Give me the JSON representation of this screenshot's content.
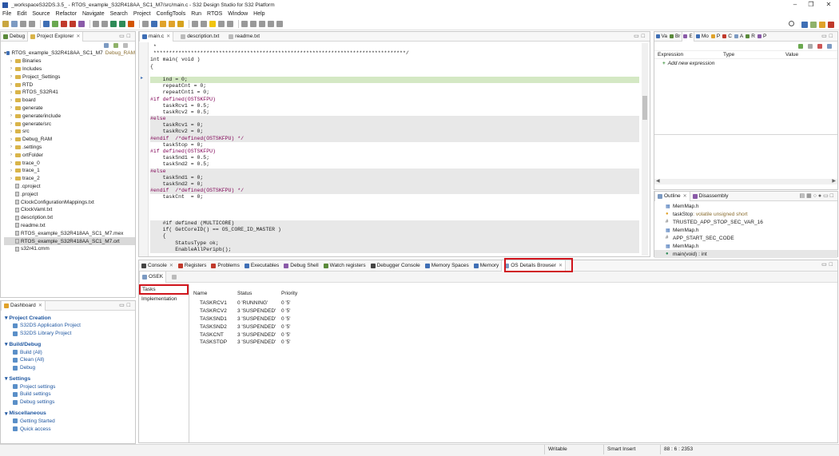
{
  "window": {
    "title": "_workspaceS32DS.3.5_ - RTOS_example_S32R418AA_SC1_M7/src/main.c - S32 Design Studio for S32 Platform"
  },
  "menu": [
    "File",
    "Edit",
    "Source",
    "Refactor",
    "Navigate",
    "Search",
    "Project",
    "ConfigTools",
    "Run",
    "RTOS",
    "Window",
    "Help"
  ],
  "left_panel": {
    "tabs": [
      {
        "label": "Debug"
      },
      {
        "label": "Project Explorer"
      }
    ],
    "project_root": "RTOS_example_S32R418AA_SC1_M7",
    "project_config": "Debug_RAM",
    "tree": [
      {
        "label": "Binaries",
        "kind": "folder"
      },
      {
        "label": "Includes",
        "kind": "folder"
      },
      {
        "label": "Project_Settings",
        "kind": "folder"
      },
      {
        "label": "RTD",
        "kind": "folder"
      },
      {
        "label": "RTOS_S32R41",
        "kind": "folder"
      },
      {
        "label": "board",
        "kind": "folder"
      },
      {
        "label": "generate",
        "kind": "folder"
      },
      {
        "label": "generate/include",
        "kind": "folder"
      },
      {
        "label": "generate/src",
        "kind": "folder"
      },
      {
        "label": "src",
        "kind": "folder"
      },
      {
        "label": "Debug_RAM",
        "kind": "folder"
      },
      {
        "label": ".settings",
        "kind": "folder"
      },
      {
        "label": "ortFolder",
        "kind": "folder"
      },
      {
        "label": "trace_0",
        "kind": "folder"
      },
      {
        "label": "trace_1",
        "kind": "folder"
      },
      {
        "label": "trace_2",
        "kind": "folder"
      },
      {
        "label": ".cproject",
        "kind": "file"
      },
      {
        "label": ".project",
        "kind": "file"
      },
      {
        "label": "ClockConfigurationMappings.txt",
        "kind": "file"
      },
      {
        "label": "ClockVaml.txt",
        "kind": "file"
      },
      {
        "label": "description.txt",
        "kind": "file"
      },
      {
        "label": "readme.txt",
        "kind": "file"
      },
      {
        "label": "RTOS_example_S32R418AA_SC1_M7.mex",
        "kind": "file"
      },
      {
        "label": "RTOS_example_S32R418AA_SC1_M7.ort",
        "kind": "file"
      },
      {
        "label": "s32r41.cmm",
        "kind": "file"
      }
    ]
  },
  "editor": {
    "tabs": [
      {
        "label": "main.c"
      },
      {
        "label": "description.txt"
      },
      {
        "label": "readme.txt"
      }
    ],
    "lines": [
      {
        "text": " *",
        "hl": false
      },
      {
        "text": " *********************************************************************************/",
        "hl": false
      },
      {
        "text": "int main( void )",
        "hl": false
      },
      {
        "text": "{",
        "hl": false
      },
      {
        "text": "",
        "hl": false
      },
      {
        "text": "    ind = 0;",
        "hl": false,
        "green": true
      },
      {
        "text": "    repeatCnt = 0;",
        "hl": false
      },
      {
        "text": "    repeatCnt1 = 0;",
        "hl": false
      },
      {
        "text": "#if defined(OSTSKFPU)",
        "hl": false
      },
      {
        "text": "    taskRcv1 = 0.5;",
        "hl": false
      },
      {
        "text": "    taskRcv2 = 0.5;",
        "hl": false
      },
      {
        "text": "#else",
        "hl": true
      },
      {
        "text": "    taskRcv1 = 0;",
        "hl": true
      },
      {
        "text": "    taskRcv2 = 0;",
        "hl": true
      },
      {
        "text": "#endif  /*defined(OSTSKFPU) */",
        "hl": true
      },
      {
        "text": "    taskStop = 0;",
        "hl": false
      },
      {
        "text": "#if defined(OSTSKFPU)",
        "hl": false
      },
      {
        "text": "    taskSnd1 = 0.5;",
        "hl": false
      },
      {
        "text": "    taskSnd2 = 0.5;",
        "hl": false
      },
      {
        "text": "#else",
        "hl": true
      },
      {
        "text": "    taskSnd1 = 0;",
        "hl": true
      },
      {
        "text": "    taskSnd2 = 0;",
        "hl": true
      },
      {
        "text": "#endif  /*defined(OSTSKFPU) */",
        "hl": true
      },
      {
        "text": "    taskCnt  = 0;",
        "hl": false
      },
      {
        "text": "",
        "hl": false
      },
      {
        "text": "",
        "hl": false
      },
      {
        "text": "",
        "hl": false
      },
      {
        "text": "    #if defined (MULTICORE)",
        "hl": true
      },
      {
        "text": "    if( GetCoreID() == OS_CORE_ID_MASTER )",
        "hl": true
      },
      {
        "text": "    {",
        "hl": true
      },
      {
        "text": "        StatusType ok;",
        "hl": true
      },
      {
        "text": "        EnableAllPeripb();",
        "hl": true
      }
    ]
  },
  "expressions": {
    "tabs": [
      "Va",
      "Br",
      "E",
      "Mo",
      "P",
      "C",
      "A",
      "R",
      "P"
    ],
    "columns": [
      "Expression",
      "Type",
      "Value"
    ],
    "add_label": "Add new expression"
  },
  "outline": {
    "tabs": [
      {
        "label": "Outline"
      },
      {
        "label": "Disassembly"
      }
    ],
    "items": [
      {
        "icon": "header",
        "label": "MemMap.h"
      },
      {
        "icon": "var",
        "label": "taskStop",
        "detail": " : volatile unsigned short"
      },
      {
        "icon": "hash",
        "label": "TRUSTED_APP_STOP_SEC_VAR_16"
      },
      {
        "icon": "header",
        "label": "MemMap.h"
      },
      {
        "icon": "hash",
        "label": "APP_START_SEC_CODE"
      },
      {
        "icon": "header",
        "label": "MemMap.h"
      },
      {
        "icon": "func",
        "label": "main(void) : int"
      }
    ]
  },
  "dashboard": {
    "title": "Dashboard",
    "sections": [
      {
        "title": "Project Creation",
        "links": [
          "S32DS Application Project",
          "S32DS Library Project"
        ]
      },
      {
        "title": "Build/Debug",
        "links": [
          "Build  (All)",
          "Clean  (All)",
          "Debug"
        ]
      },
      {
        "title": "Settings",
        "links": [
          "Project settings",
          "Build settings",
          "Debug settings"
        ]
      },
      {
        "title": "Miscellaneous",
        "links": [
          "Getting Started",
          "Quick access"
        ]
      }
    ]
  },
  "bottom_panel": {
    "tabs": [
      {
        "label": "Console"
      },
      {
        "label": "Registers"
      },
      {
        "label": "Problems"
      },
      {
        "label": "Executables"
      },
      {
        "label": "Debug Shell"
      },
      {
        "label": "Watch registers"
      },
      {
        "label": "Debugger Console"
      },
      {
        "label": "Memory Spaces"
      },
      {
        "label": "Memory"
      },
      {
        "label": "OS Details Browser"
      }
    ],
    "os_tab": "OSEK",
    "sidebar": [
      "Tasks",
      "Implementation"
    ],
    "table": {
      "columns": [
        "Name",
        "Status",
        "Priority"
      ],
      "rows": [
        {
          "name": "TASKRCV1",
          "status": "0 'RUNNING'",
          "priority": "0 '5'"
        },
        {
          "name": "TASKRCV2",
          "status": "3 'SUSPENDED'",
          "priority": "0 '5'"
        },
        {
          "name": "TASKSND1",
          "status": "3 'SUSPENDED'",
          "priority": "0 '5'"
        },
        {
          "name": "TASKSND2",
          "status": "3 'SUSPENDED'",
          "priority": "0 '5'"
        },
        {
          "name": "TASKCNT",
          "status": "3 'SUSPENDED'",
          "priority": "0 '5'"
        },
        {
          "name": "TASKSTOP",
          "status": "3 'SUSPENDED'",
          "priority": "0 '5'"
        }
      ]
    }
  },
  "statusbar": {
    "writable": "Writable",
    "insert": "Smart Insert",
    "position": "88 : 6 : 2353"
  },
  "colors": {
    "highlight_red": "#d0141c",
    "link_blue": "#1e56a0",
    "code_bg_hl": "#e8e8e8"
  }
}
